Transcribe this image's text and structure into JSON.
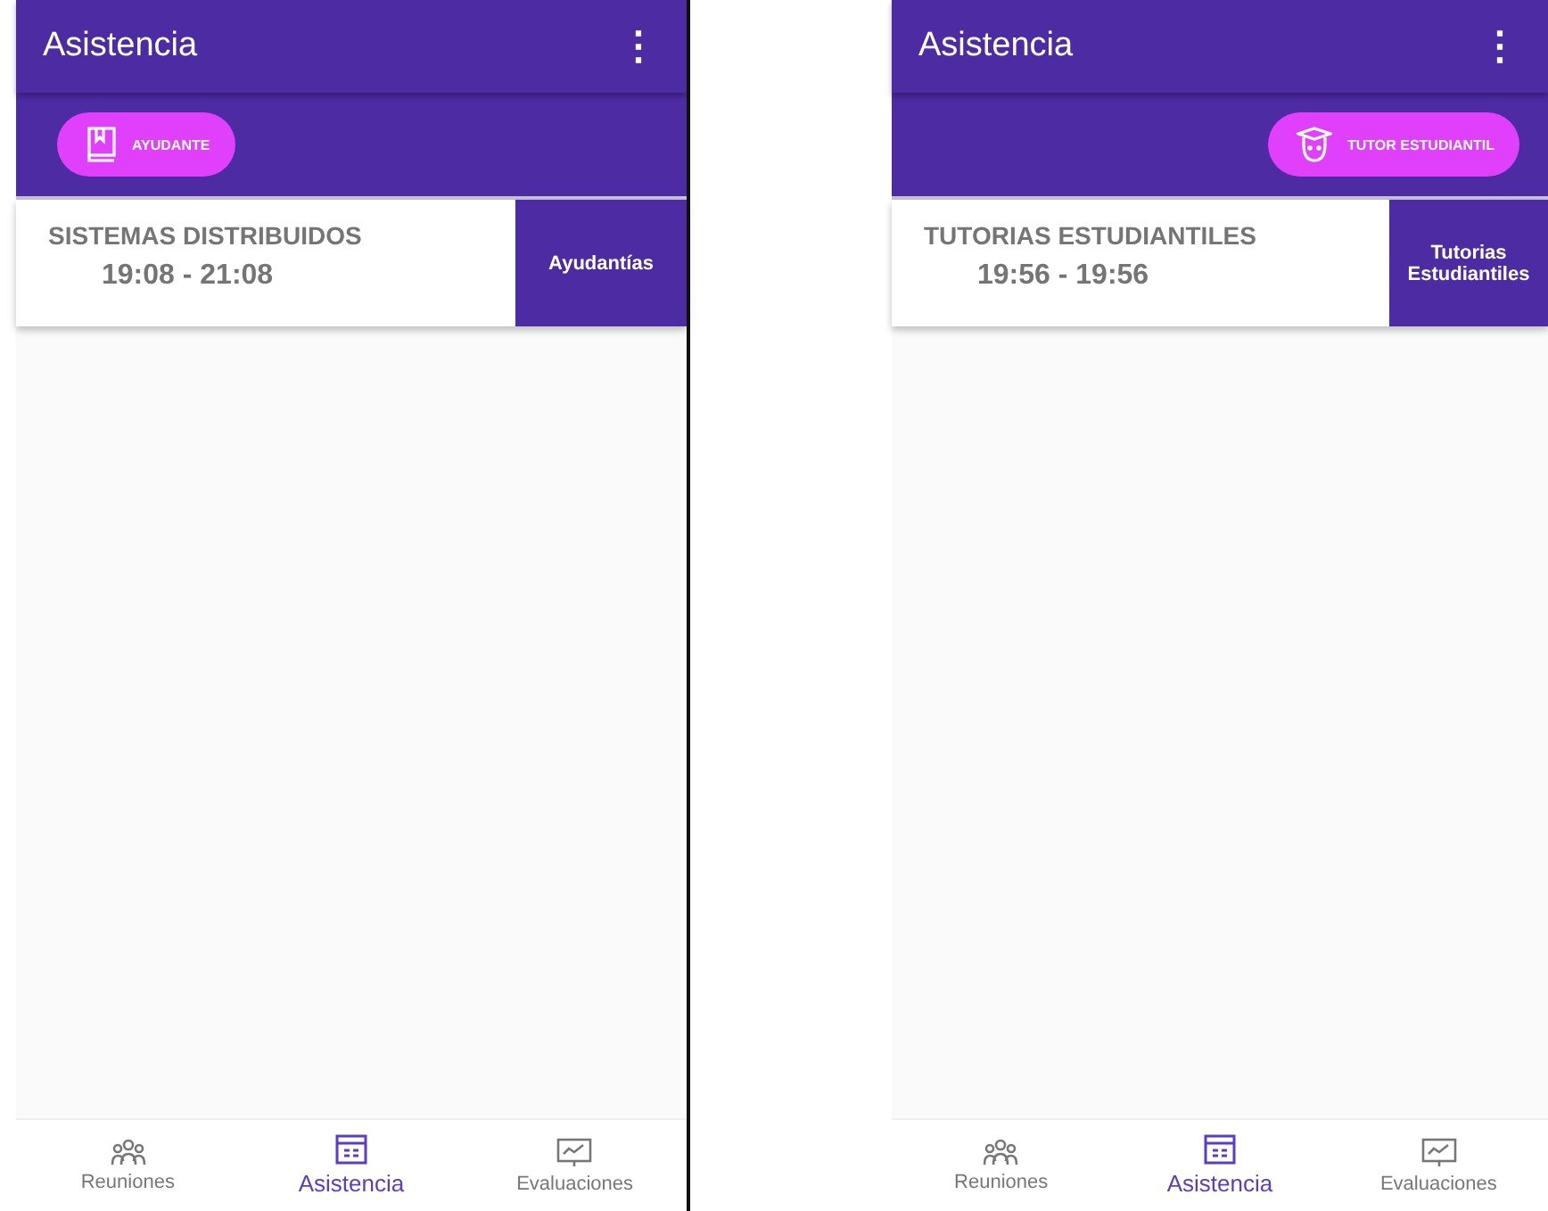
{
  "screens": [
    {
      "title": "Asistencia",
      "menu_icon": "⋮",
      "chip": {
        "kind": "book",
        "label": "AYUDANTE"
      },
      "cards": [
        {
          "title": "SISTEMAS DISTRIBUIDOS",
          "time": "19:08 - 21:08",
          "action": "Ayudantías"
        }
      ],
      "nav": [
        {
          "label": "Reuniones",
          "kind": "people",
          "selected": false
        },
        {
          "label": "Asistencia",
          "kind": "calendar",
          "selected": true
        },
        {
          "label": "Evaluaciones",
          "kind": "chart",
          "selected": false
        }
      ]
    },
    {
      "title": "Asistencia",
      "menu_icon": "⋮",
      "chip": {
        "kind": "graduate",
        "label": "TUTOR ESTUDIANTIL"
      },
      "cards": [
        {
          "title": "TUTORIAS ESTUDIANTILES",
          "time": "19:56 - 19:56",
          "action": "Tutorias Estudiantiles"
        }
      ],
      "nav": [
        {
          "label": "Reuniones",
          "kind": "people",
          "selected": false
        },
        {
          "label": "Asistencia",
          "kind": "calendar",
          "selected": true
        },
        {
          "label": "Evaluaciones",
          "kind": "chart",
          "selected": false
        }
      ]
    }
  ]
}
